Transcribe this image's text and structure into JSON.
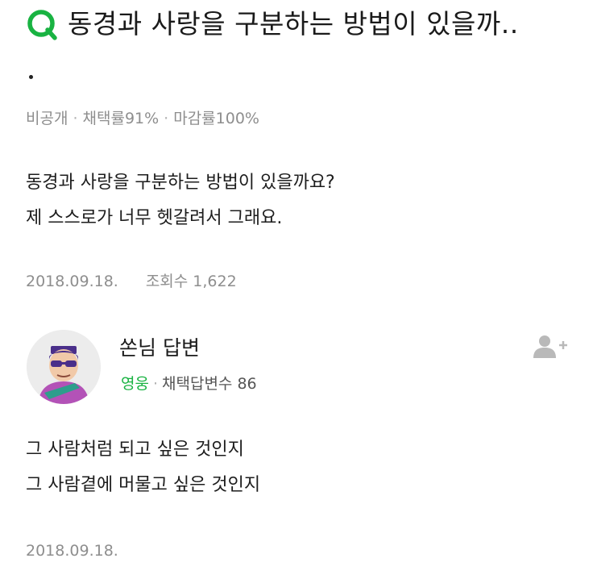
{
  "question": {
    "title": "동경과 사랑을 구분하는 방법이 있을까..",
    "visibility": "비공개",
    "adoption_rate": "채택률91%",
    "closing_rate": "마감률100%",
    "body_lines": [
      "동경과 사랑을 구분하는 방법이 있을까요?",
      "제 스스로가 너무 헷갈려서 그래요."
    ],
    "date": "2018.09.18.",
    "views": "조회수 1,622"
  },
  "answer": {
    "author": "쏜님 답변",
    "level": "영웅",
    "adopted_count_label": "채택답변수",
    "adopted_count": "86",
    "body_lines": [
      "그 사람처럼 되고 싶은 것인지",
      "그 사람곁에 머물고 싶은 것인지"
    ],
    "date": "2018.09.18."
  },
  "icons": {
    "question_icon": "q-letter-icon",
    "add_friend_icon": "add-friend-icon",
    "avatar": "character-avatar"
  },
  "colors": {
    "accent_green": "#19b342",
    "meta_gray": "#8e8e8e",
    "add_friend_gray": "#b9b9b9"
  }
}
